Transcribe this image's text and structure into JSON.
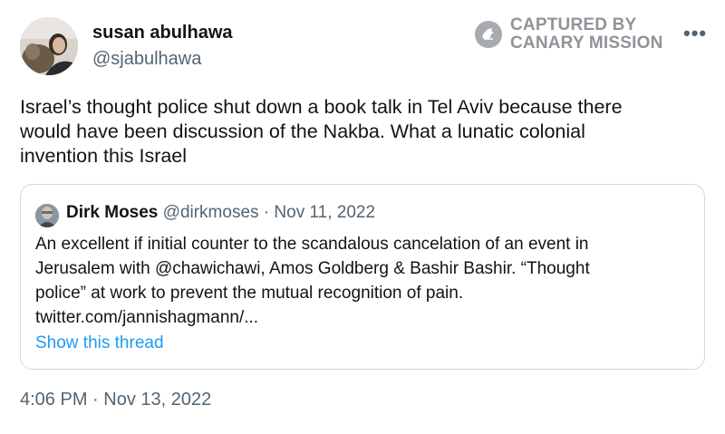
{
  "author": {
    "name": "susan abulhawa",
    "handle": "@sjabulhawa"
  },
  "watermark": {
    "line1": "CAPTURED BY",
    "line2": "CANARY MISSION",
    "icon": "canary-mission-logo"
  },
  "more_label": "•••",
  "tweet": {
    "lines": [
      "Israel’s thought police shut down a book talk in Tel Aviv because there",
      "would have been discussion of the Nakba. What a lunatic colonial",
      "invention this Israel"
    ]
  },
  "quote": {
    "name": "Dirk Moses",
    "meta": "@dirkmoses · Nov 11, 2022",
    "lines": [
      "An excellent if initial counter to the scandalous cancelation of an event in",
      "Jerusalem with @chawichawi, Amos Goldberg & Bashir Bashir. “Thought",
      "police” at work to prevent the mutual recognition of pain.",
      "twitter.com/jannishagmann/..."
    ],
    "show_thread": "Show this thread"
  },
  "timestamp": "4:06 PM · Nov 13, 2022",
  "colors": {
    "link": "#1d9bf0",
    "secondary_text": "#536471",
    "border": "#cfd9de",
    "watermark": "#8f9499"
  }
}
